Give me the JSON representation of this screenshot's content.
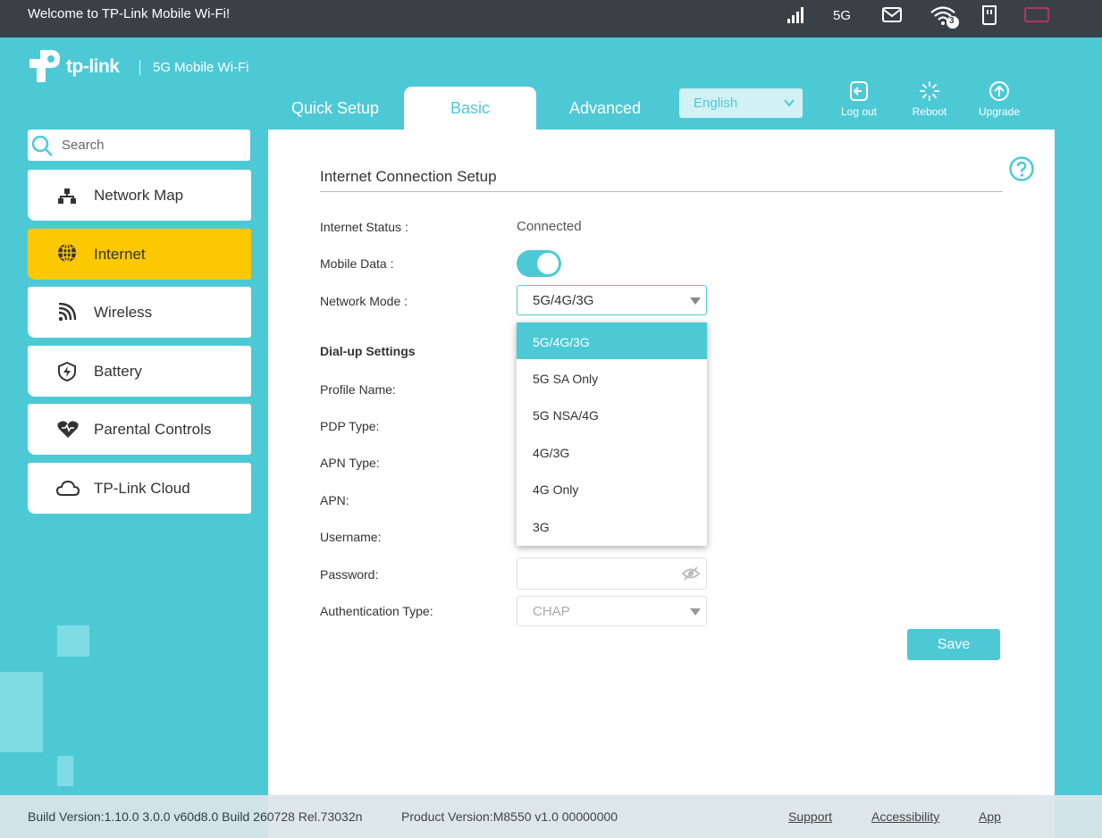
{
  "topbar": {
    "welcome": "Welcome to TP-Link Mobile Wi-Fi!",
    "network_type": "5G",
    "wifi_clients": "3",
    "icons": [
      "signal-icon",
      "mail-icon",
      "wifi-icon",
      "sim-card-icon",
      "battery-icon"
    ],
    "battery_color": "#d6336c"
  },
  "brand": {
    "logo_text": "tp-link",
    "product": "5G Mobile Wi-Fi"
  },
  "tabs": [
    {
      "label": "Quick Setup",
      "active": false
    },
    {
      "label": "Basic",
      "active": true
    },
    {
      "label": "Advanced",
      "active": false
    }
  ],
  "language": {
    "selected": "English"
  },
  "header_buttons": {
    "logout": "Log out",
    "reboot": "Reboot",
    "upgrade": "Upgrade"
  },
  "search": {
    "placeholder": "Search"
  },
  "sidebar": {
    "items": [
      {
        "label": "Network Map",
        "icon": "network-map-icon"
      },
      {
        "label": "Internet",
        "icon": "globe-icon",
        "active": true
      },
      {
        "label": "Wireless",
        "icon": "wireless-icon"
      },
      {
        "label": "Battery",
        "icon": "battery-shield-icon"
      },
      {
        "label": "Parental Controls",
        "icon": "heart-icon"
      },
      {
        "label": "TP-Link Cloud",
        "icon": "cloud-icon"
      }
    ]
  },
  "main": {
    "section_title": "Internet Connection Setup",
    "internet_status_label": "Internet Status :",
    "internet_status_value": "Connected",
    "mobile_data_label": "Mobile Data :",
    "mobile_data_on": true,
    "network_mode_label": "Network Mode :",
    "network_mode_value": "5G/4G/3G",
    "network_mode_options": [
      "5G/4G/3G",
      "5G SA Only",
      "5G NSA/4G",
      "4G/3G",
      "4G Only",
      "3G"
    ],
    "dialup_title": "Dial-up Settings",
    "profile_name_label": "Profile Name:",
    "pdp_type_label": "PDP Type:",
    "apn_type_label": "APN Type:",
    "apn_label": "APN:",
    "username_label": "Username:",
    "password_label": "Password:",
    "auth_type_label": "Authentication Type:",
    "auth_type_value": "CHAP",
    "save_label": "Save"
  },
  "footer": {
    "build_version": "Build Version:1.10.0 3.0.0 v60d8.0 Build 260728 Rel.73032n",
    "product_version": "Product Version:M8550 v1.0 00000000",
    "support": "Support",
    "accessibility": "Accessibility",
    "app": "App"
  },
  "colors": {
    "accent": "#4dc9d6",
    "topbar": "#3a4146",
    "active_nav": "#fcc800"
  }
}
